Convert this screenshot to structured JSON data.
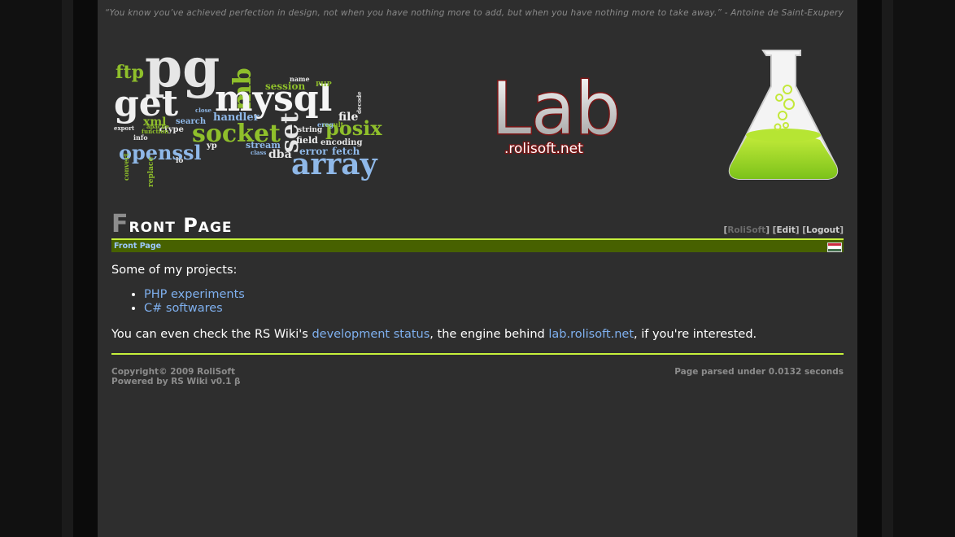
{
  "quote": "“You know you’ve achieved perfection in design, not when you have nothing more to add, but when you have nothing more to take away.” - Antoine de Saint-Exupery",
  "header": {
    "word_cloud": [
      "ftp",
      "pg",
      "mb",
      "get",
      "mysql",
      "session",
      "PHP",
      "socket",
      "set",
      "posix",
      "openssl",
      "array",
      "handler",
      "search",
      "xml",
      "ctype",
      "file",
      "string",
      "encoding",
      "field",
      "error",
      "fetch",
      "stream",
      "dba",
      "replace",
      "convert",
      "info",
      "function",
      "apache",
      "export",
      "decode",
      "result",
      "name",
      "ereg",
      "close",
      "yp",
      "lo",
      "class"
    ],
    "logo_title": "Lab",
    "logo_subtitle": ".rolisoft.net"
  },
  "page": {
    "title_first_letter": "F",
    "title_rest": "ront Page",
    "user_links": {
      "owner": "RoliSoft",
      "edit": "Edit",
      "logout": "Logout"
    },
    "breadcrumb": "Front Page"
  },
  "content": {
    "intro": "Some of my projects:",
    "projects": [
      "PHP experiments",
      "C# softwares"
    ],
    "more_before": "You can even check the RS Wiki's ",
    "dev_link": "development status",
    "more_middle": ", the engine behind ",
    "site_link": "lab.rolisoft.net",
    "more_after": ", if you're interested."
  },
  "footer": {
    "copyright": "Copyright© 2009 RoliSoft",
    "powered": "Powered by RS Wiki v0.1 β",
    "timing": "Page parsed under 0.0132 seconds"
  },
  "colors": {
    "accent": "#c6f03b",
    "bar": "#476100",
    "link": "#7fb0ef",
    "background": "#2e2e2e"
  }
}
